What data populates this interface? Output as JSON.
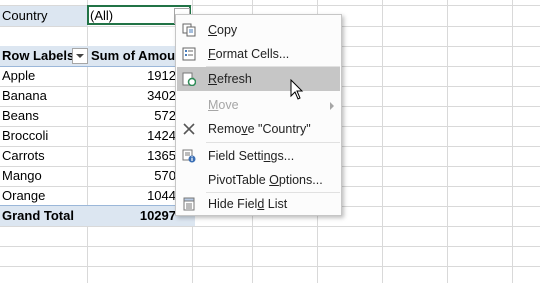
{
  "filter": {
    "label": "Country",
    "value": "(All)"
  },
  "pivot": {
    "headers": [
      "Row Labels",
      "Sum of Amount"
    ],
    "rows": [
      {
        "label": "Apple",
        "value": "1912"
      },
      {
        "label": "Banana",
        "value": "3402"
      },
      {
        "label": "Beans",
        "value": "572"
      },
      {
        "label": "Broccoli",
        "value": "1424"
      },
      {
        "label": "Carrots",
        "value": "1365"
      },
      {
        "label": "Mango",
        "value": "570"
      },
      {
        "label": "Orange",
        "value": "1044"
      }
    ],
    "grand_total": {
      "label": "Grand Total",
      "value": "10297"
    }
  },
  "context_menu": {
    "items": [
      {
        "pre": "",
        "key": "C",
        "post": "opy",
        "state": "normal"
      },
      {
        "pre": "",
        "key": "F",
        "post": "ormat Cells...",
        "state": "normal"
      },
      {
        "pre": "",
        "key": "R",
        "post": "efresh",
        "state": "hover"
      },
      {
        "pre": "",
        "key": "M",
        "post": "ove",
        "state": "disabled"
      },
      {
        "pre": "Remo",
        "key": "v",
        "post": "e \"Country\"",
        "state": "normal"
      },
      {
        "pre": "Field Setti",
        "key": "n",
        "post": "gs...",
        "state": "normal"
      },
      {
        "pre": "PivotTable ",
        "key": "O",
        "post": "ptions...",
        "state": "normal"
      },
      {
        "pre": "Hide Fiel",
        "key": "d",
        "post": " List",
        "state": "normal"
      }
    ]
  },
  "colors": {
    "accent_green": "#217346",
    "pivot_band": "#dce6f1",
    "menu_hover": "#c6c6c6",
    "disabled_text": "#a6a6a6"
  }
}
